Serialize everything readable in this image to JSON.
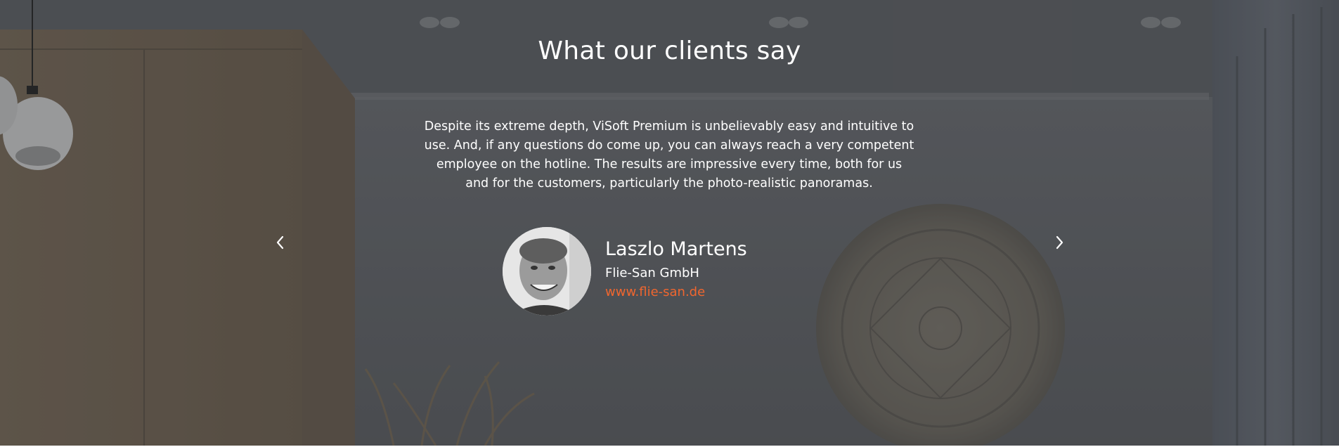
{
  "testimonials": {
    "heading": "What our clients say",
    "quote": "Despite its extreme depth, ViSoft Premium is unbelievably easy and intuitive to use. And, if any questions do come up, you can always reach a very competent employee on the hotline. The results are impressive every time, both for us and for the customers, particularly the photo-realistic panoramas.",
    "author": {
      "name": "Laszlo Martens",
      "company": "Flie-San GmbH",
      "website": "www.flie-san.de"
    },
    "controls": {
      "prev_icon": "chevron-left-icon",
      "next_icon": "chevron-right-icon"
    }
  },
  "colors": {
    "link": "#f0662f",
    "text": "#ffffff",
    "overlay": "#3a3d42"
  }
}
